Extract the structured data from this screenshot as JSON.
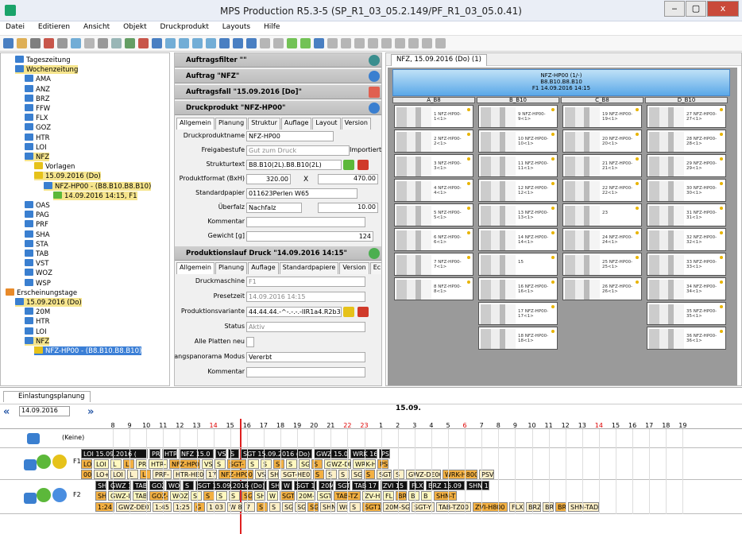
{
  "window": {
    "title": "MPS Production R5.3-5 (SP_R1_03_05.2.149/PF_R1_03_05.0.41)",
    "buttons": [
      "‒",
      "▢",
      "x"
    ]
  },
  "menu": [
    "Datei",
    "Editieren",
    "Ansicht",
    "Objekt",
    "Druckprodukt",
    "Layouts",
    "Hilfe"
  ],
  "tree": {
    "items": [
      {
        "label": "Tageszeitung",
        "depth": 1
      },
      {
        "label": "Wochenzeitung",
        "depth": 1,
        "hl": true
      },
      {
        "label": "AMA",
        "depth": 2
      },
      {
        "label": "ANZ",
        "depth": 2
      },
      {
        "label": "BRZ",
        "depth": 2
      },
      {
        "label": "FFW",
        "depth": 2
      },
      {
        "label": "FLX",
        "depth": 2
      },
      {
        "label": "GOZ",
        "depth": 2
      },
      {
        "label": "HTR",
        "depth": 2
      },
      {
        "label": "LOI",
        "depth": 2
      },
      {
        "label": "NFZ",
        "depth": 2,
        "hl": true
      },
      {
        "label": "Vorlagen",
        "depth": 3
      },
      {
        "label": "15.09.2016 (Do)",
        "depth": 3,
        "hl": true
      },
      {
        "label": "NFZ-HP00 - (B8.B10.B8.B10)",
        "depth": 4,
        "hl": true
      },
      {
        "label": "14.09.2016 14:15, F1",
        "depth": 5,
        "hl": true
      },
      {
        "label": "OAS",
        "depth": 2
      },
      {
        "label": "PAG",
        "depth": 2
      },
      {
        "label": "PRF",
        "depth": 2
      },
      {
        "label": "SHA",
        "depth": 2
      },
      {
        "label": "STA",
        "depth": 2
      },
      {
        "label": "TAB",
        "depth": 2
      },
      {
        "label": "VST",
        "depth": 2
      },
      {
        "label": "WOZ",
        "depth": 2
      },
      {
        "label": "WSP",
        "depth": 2
      },
      {
        "label": "Erscheinungstage",
        "depth": 0
      },
      {
        "label": "15.09.2016 (Do)",
        "depth": 1,
        "hl": true
      },
      {
        "label": "20M",
        "depth": 2
      },
      {
        "label": "HTR",
        "depth": 2
      },
      {
        "label": "LOI",
        "depth": 2
      },
      {
        "label": "NFZ",
        "depth": 2,
        "hl": true
      },
      {
        "label": "NFZ-HP00 - (B8.B10.B8.B10)",
        "depth": 3,
        "sel": true
      }
    ]
  },
  "props": {
    "sections": {
      "auftragsfilter": "Auftragsfilter \"\"",
      "auftrag": "Auftrag \"NFZ\"",
      "auftragsfall": "Auftragsfall \"15.09.2016 [Do]\"",
      "druckprodukt": "Druckprodukt \"NFZ-HP00\"",
      "produktionslauf": "Produktionslauf Druck \"14.09.2016 14:15\""
    },
    "tabs1": [
      "Allgemein",
      "Planung",
      "Struktur",
      "Auflage",
      "Layout",
      "Version"
    ],
    "fields1": [
      {
        "label": "Druckproduktname",
        "value": "NFZ-HP00"
      },
      {
        "label": "Freigabestufe",
        "value": "Gut zum Druck"
      },
      {
        "label": "Strukturtext",
        "value": "B8.B10(2L).B8.B10(2L)"
      },
      {
        "label": "Produktformat (BxH)",
        "value": "320.00"
      },
      {
        "label": "Standardpapier",
        "value": "011623Perlen W65"
      },
      {
        "label": "Überfalz",
        "value": "Nachfalz"
      },
      {
        "label": "Kommentar",
        "value": ""
      },
      {
        "label": "Gewicht [g]",
        "value": "124"
      }
    ],
    "importiert": "Importiert",
    "format_x": "X",
    "format_h": "470.00",
    "ueberfalz_val": "10.00",
    "tabs2": [
      "Allgemein",
      "Planung",
      "Auflage",
      "Standardpapiere",
      "Version",
      "Eck"
    ],
    "fields2": [
      {
        "label": "Druckmaschine",
        "value": "F1"
      },
      {
        "label": "Presetzeit",
        "value": "14.09.2016 14:15"
      },
      {
        "label": "Produktionsvariante",
        "value": "44.44.44.-^-.-.-.-IIR1a4.R2b3.R3a"
      },
      {
        "label": "Status",
        "value": "Aktiv"
      },
      {
        "label": "Alle Platten neu",
        "value": ""
      },
      {
        "label": "vangspanorama Modus",
        "value": "Vererbt"
      },
      {
        "label": "Kommentar",
        "value": ""
      }
    ]
  },
  "docview": {
    "tab": "NFZ, 15.09.2016 (Do) (1)",
    "header": [
      "NFZ-HP00 (1/-)",
      "B8.B10.B8.B10",
      "F1 14.09.2016 14:15"
    ],
    "columns": [
      "A_B8",
      "B_B10",
      "C_B8",
      "D_B10"
    ],
    "pages_A": [
      "1 NFZ-HP00-1<1>",
      "2 NFZ-HP00-2<1>",
      "3 NFZ-HP00-3<1>",
      "4 NFZ-HP00-4<1>",
      "5 NFZ-HP00-5<1>",
      "6 NFZ-HP00-6<1>",
      "7 NFZ-HP00-7<1>",
      "8 NFZ-HP00-8<1>"
    ],
    "pages_B": [
      "9 NFZ-HP00-9<1>",
      "10 NFZ-HP00-10<1>",
      "11 NFZ-HP00-11<1>",
      "12 NFZ-HP00-12<1>",
      "13 NFZ-HP00-13<1>",
      "14 NFZ-HP00-14<1>",
      "15",
      "16 NFZ-HP00-16<1>",
      "17 NFZ-HP00-17<1>",
      "18 NFZ-HP00-18<1>"
    ],
    "pages_C": [
      "19 NFZ-HP00-19<1>",
      "20 NFZ-HP00-20<1>",
      "21 NFZ-HP00-21<1>",
      "22 NFZ-HP00-22<1>",
      "23",
      "24 NFZ-HP00-24<1>",
      "25 NFZ-HP00-25<1>",
      "26 NFZ-HP00-26<1>"
    ],
    "pages_D": [
      "27 NFZ-HP00-27<1>",
      "28 NFZ-HP00-28<1>",
      "29 NFZ-HP00-29<1>",
      "30 NFZ-HP00-30<1>",
      "31 NFZ-HP00-31<1>",
      "32 NFZ-HP00-32<1>",
      "33 NFZ-HP00-33<1>",
      "34 NFZ-HP00-34<1>",
      "35 NFZ-HP00-35<1>",
      "36 NFZ-HP00-36<1>"
    ]
  },
  "planner": {
    "tab": "Einlastungsplanung",
    "date": "14.09.2016",
    "nextday": "15.09.",
    "hours": [
      "8",
      "9",
      "10",
      "11",
      "12",
      "13",
      "14",
      "15",
      "16",
      "17",
      "18",
      "19",
      "20",
      "21",
      "22",
      "23",
      "1",
      "2",
      "3",
      "4",
      "5",
      "6",
      "7",
      "8",
      "9",
      "10",
      "11",
      "12",
      "13",
      "14",
      "15",
      "16",
      "17",
      "18",
      "19"
    ],
    "red_hours": [
      6,
      14,
      15,
      21,
      29
    ],
    "keine": "(Keine)",
    "f1": "F1",
    "f2": "F2",
    "f1_blocks": [
      "LOI 15.09.2016 (",
      "PR",
      "HTR",
      "NFZ 15.0",
      "VS",
      "S",
      "SGT 15.09.2016 (Do)",
      "GWZ 15.0",
      "WRK 16",
      "PS"
    ],
    "f1_blocks2": [
      "LO",
      "LOI",
      "L",
      "L",
      "PR",
      "HTR-",
      "NFZ-HP0",
      "VS",
      "S",
      "SGT-",
      "S",
      "S",
      "S",
      "S",
      "SG",
      "S",
      "GWZ-DE",
      "WRK-H",
      "PS"
    ],
    "f1_blocks3": [
      "00",
      "LO+",
      "LOI",
      "L",
      "L",
      "PRF-",
      "HTR-HE0",
      "17",
      "NFZ-HP00",
      "VS",
      "SH",
      "SGT-HE0",
      "S",
      "S",
      "S",
      "SG",
      "S",
      "SGT",
      "S",
      "GWZ-DE00",
      "WRK-H800",
      "PSV"
    ],
    "f2_blocks": [
      "SH",
      "GWZ 1",
      "TAB",
      "GOZ",
      "WOZ",
      "S",
      "SGT 15.09.2016 (Do)",
      "SH",
      "W",
      "SGT 1",
      "20M",
      "SGT",
      "TAB 17",
      "ZVI 15",
      "FLX",
      "BRZ 15.09",
      "SHN 1"
    ],
    "f2_blocks2": [
      "SH",
      "GWZ-D",
      "TAB",
      "GOZ-",
      "WOZ-",
      "S",
      "S",
      "S",
      "S",
      "SG",
      "SH",
      "W",
      "SGT",
      "20M-",
      "SGT",
      "TAB-TZ",
      "ZV-H",
      "FL",
      "BR",
      "B",
      "B",
      "SHN-T"
    ],
    "f2_blocks3": [
      "1:24",
      "GWZ-DE01",
      "1:45",
      "1:25",
      "G",
      "1:03",
      "W 8",
      "7",
      "S",
      "S",
      "SG",
      "SG",
      "SG",
      "SHN",
      "WO",
      "S",
      "SGT1",
      "20M-SG",
      "SGT-Y",
      "TAB-TZ00",
      "ZVI-H800",
      "FLX",
      "BRZ",
      "BR",
      "BR",
      "SHN-TAD"
    ]
  }
}
